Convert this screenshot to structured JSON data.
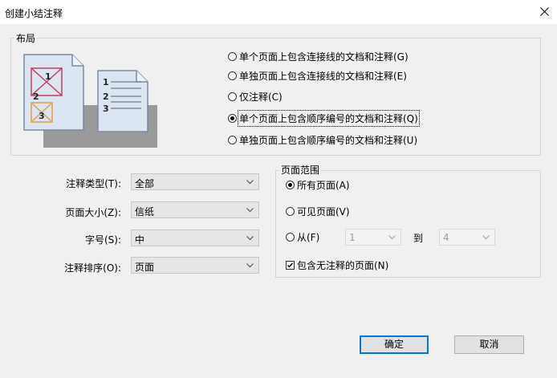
{
  "window": {
    "title": "创建小结注释",
    "close_icon": "close-icon"
  },
  "layout_group": {
    "label": "布局",
    "illustration": {
      "doc1_numbers": [
        "1",
        "2",
        "3"
      ],
      "doc2_numbers": [
        "1",
        "2",
        "3"
      ]
    },
    "options": [
      {
        "label": "单个页面上包含连接线的文档和注释(G)",
        "checked": false
      },
      {
        "label": "单独页面上包含连接线的文档和注释(E)",
        "checked": false
      },
      {
        "label": "仅注释(C)",
        "checked": false
      },
      {
        "label": "单个页面上包含顺序编号的文档和注释(Q)",
        "checked": true
      },
      {
        "label": "单独页面上包含顺序编号的文档和注释(U)",
        "checked": false
      }
    ]
  },
  "fields": {
    "comment_type": {
      "label": "注释类型(T):",
      "value": "全部"
    },
    "page_size": {
      "label": "页面大小(Z):",
      "value": "信纸"
    },
    "font_size": {
      "label": "字号(S):",
      "value": "中"
    },
    "sort_by": {
      "label": "注释排序(O):",
      "value": "页面"
    }
  },
  "page_range": {
    "label": "页面范围",
    "all_pages": {
      "label": "所有页面(A)",
      "checked": true
    },
    "visible_pages": {
      "label": "可见页面(V)",
      "checked": false
    },
    "from": {
      "label": "从(F)",
      "checked": false,
      "from_value": "1",
      "to_label": "到",
      "to_value": "4"
    },
    "include_no_comments": {
      "label": "包含无注释的页面(N)",
      "checked": true
    }
  },
  "buttons": {
    "ok": "确定",
    "cancel": "取消"
  },
  "colors": {
    "accent": "#0078d7",
    "doc_fill": "#dce6f2",
    "doc_border": "#7a8aa0",
    "shadow": "#9a9a9a",
    "cross_red": "#c0405a",
    "cross_orange": "#e0a040"
  }
}
